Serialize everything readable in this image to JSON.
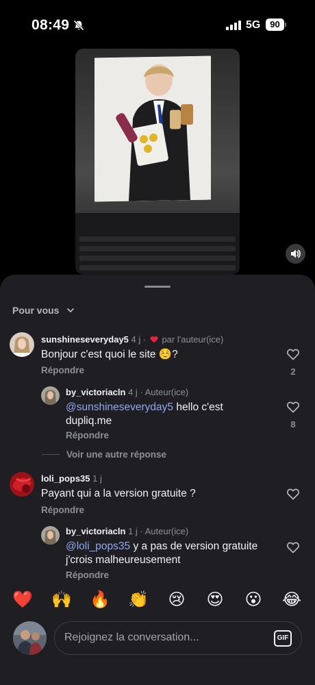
{
  "status_bar": {
    "time": "08:49",
    "network": "5G",
    "battery": "90"
  },
  "sheet": {
    "sort_label": "Pour vous"
  },
  "comments": [
    {
      "username": "sunshineseveryday5",
      "meta_prefix": "4 j ·",
      "meta_suffix": "par l'auteur(ice)",
      "text": "Bonjour c'est quoi le site ☺️?",
      "reply_label": "Répondre",
      "like_count": "2",
      "replies": [
        {
          "username": "by_victoriacln",
          "meta": "4 j · Auteur(ice)",
          "mention": "@sunshineseveryday5",
          "text": " hello c'est dupliq.me",
          "reply_label": "Répondre",
          "like_count": "8"
        }
      ],
      "more_replies_label": "Voir une autre réponse"
    },
    {
      "username": "loli_pops35",
      "meta_prefix": "1 j",
      "text": "Payant qui a la version gratuite ?",
      "reply_label": "Répondre",
      "replies": [
        {
          "username": "by_victoriacln",
          "meta": "1 j · Auteur(ice)",
          "mention": "@loli_pops35",
          "text": " y a pas de version gratuite j'crois malheureusement",
          "reply_label": "Répondre"
        }
      ]
    }
  ],
  "emoji_bar": [
    "❤️",
    "🙌",
    "🔥",
    "👏",
    "😢",
    "😍",
    "😮",
    "😂"
  ],
  "composer": {
    "placeholder": "Rejoignez la conversation...",
    "gif_label": "GIF"
  },
  "icons": {
    "bell": "bell-slash-icon",
    "signal": "cellular-signal-icon",
    "mute": "speaker-icon",
    "chevron": "chevron-down-icon",
    "like": "heart-outline-icon",
    "author_like": "heart-filled-icon"
  },
  "colors": {
    "background": "#000000",
    "sheet": "#1f1f23",
    "mention": "#8fa9f0",
    "author_heart": "#e5223f",
    "muted_text": "#8e9096"
  }
}
